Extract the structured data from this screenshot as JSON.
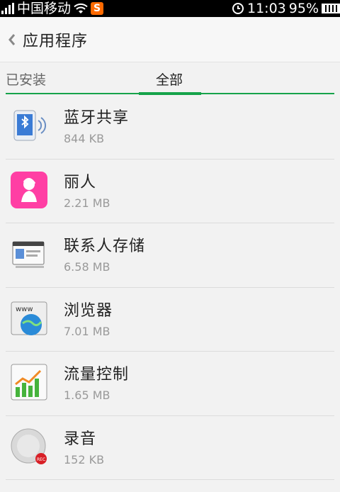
{
  "status": {
    "carrier": "中国移动",
    "notification_app": "S",
    "time": "11:03",
    "battery": "95%"
  },
  "header": {
    "title": "应用程序"
  },
  "tabs": [
    {
      "label": "已安装",
      "active": false
    },
    {
      "label": "全部",
      "active": true
    }
  ],
  "apps": [
    {
      "name": "蓝牙共享",
      "size": "844 KB",
      "icon": "bluetooth-share-icon"
    },
    {
      "name": "丽人",
      "size": "2.21 MB",
      "icon": "liren-icon"
    },
    {
      "name": "联系人存储",
      "size": "6.58 MB",
      "icon": "contacts-storage-icon"
    },
    {
      "name": "浏览器",
      "size": "7.01 MB",
      "icon": "browser-icon"
    },
    {
      "name": "流量控制",
      "size": "1.65 MB",
      "icon": "traffic-control-icon"
    },
    {
      "name": "录音",
      "size": "152 KB",
      "icon": "recorder-icon"
    }
  ],
  "colors": {
    "accent": "#16a34a",
    "pink": "#ff3fa4"
  }
}
